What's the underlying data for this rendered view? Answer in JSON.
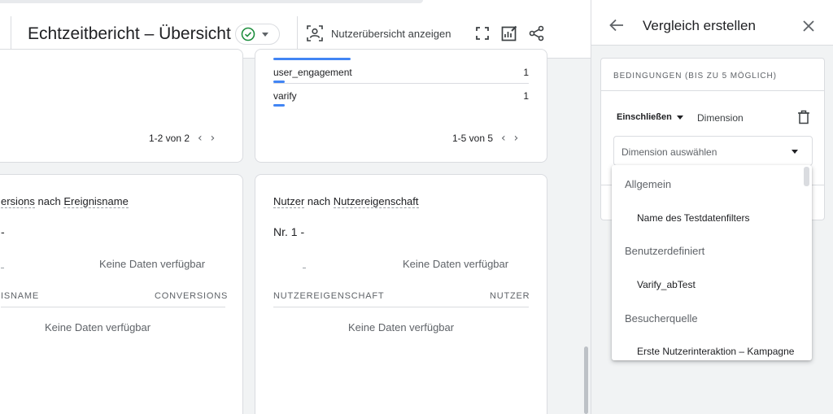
{
  "header": {
    "title": "Echtzeitbericht – Übersicht",
    "user_overview_label": "Nutzerübersicht anzeigen"
  },
  "top_left_card": {
    "pager": "1-2 von 2"
  },
  "top_mid_card": {
    "rows": [
      {
        "label": "user_engagement",
        "value": "1"
      },
      {
        "label": "varify",
        "value": "1"
      }
    ],
    "pager": "1-5 von 5"
  },
  "conversions_card": {
    "title_part1": "ersions",
    "title_mid": " nach ",
    "title_part2": "Ereignisname",
    "nr": "-",
    "chart_nodata": "Keine Daten verfügbar",
    "col_left": "ISNAME",
    "col_right": "CONVERSIONS",
    "table_nodata": "Keine Daten verfügbar"
  },
  "users_card": {
    "title_part1": "Nutzer",
    "title_mid": " nach ",
    "title_part2": "Nutzereigenschaft",
    "nr": "Nr. 1  -",
    "chart_nodata": "Keine Daten verfügbar",
    "col_left": "NUTZEREIGENSCHAFT",
    "col_right": "NUTZER",
    "table_nodata": "Keine Daten verfügbar"
  },
  "panel": {
    "title": "Vergleich erstellen",
    "conditions_title": "BEDINGUNGEN (BIS ZU 5 MÖGLICH)",
    "include_label": "Einschließen",
    "dimension_label": "Dimension",
    "select_placeholder": "Dimension auswählen"
  },
  "dropdown": {
    "groups": [
      {
        "label": "Allgemein",
        "items": [
          "Name des Testdatenfilters"
        ]
      },
      {
        "label": "Benutzerdefiniert",
        "items": [
          "Varify_abTest"
        ]
      },
      {
        "label": "Besucherquelle",
        "items": [
          "Erste Nutzerinteraktion – Kampagne"
        ]
      }
    ]
  },
  "colors": {
    "accent_blue": "#4285f4",
    "success_green": "#1e8e3e"
  },
  "icons": [
    "check-circle-icon",
    "caret-down-icon",
    "user-overview-icon",
    "fullscreen-icon",
    "edit-report-icon",
    "share-icon",
    "back-arrow-icon",
    "close-icon",
    "trash-icon",
    "chevron-left-icon",
    "chevron-right-icon"
  ]
}
